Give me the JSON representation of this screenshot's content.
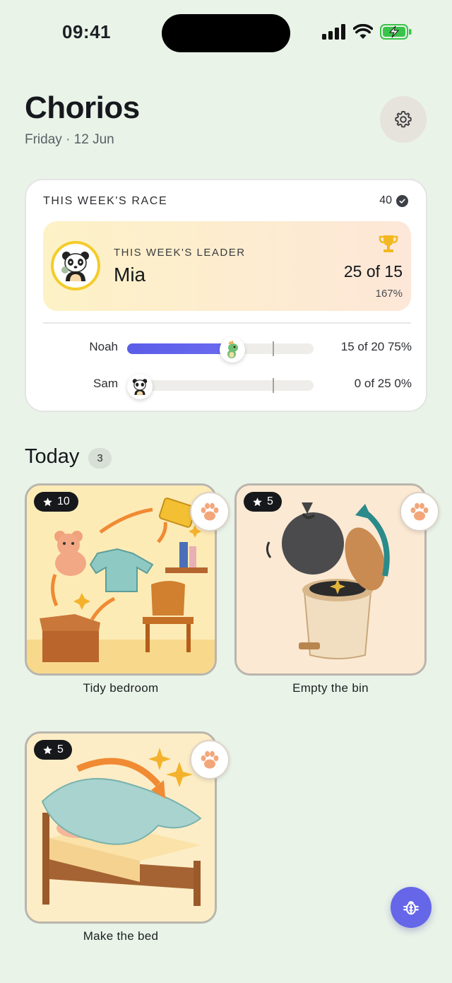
{
  "status_bar": {
    "time": "09:41"
  },
  "header": {
    "title": "Chorios",
    "date": "Friday · 12 Jun"
  },
  "race": {
    "title": "THIS WEEK'S RACE",
    "points": "40",
    "leader": {
      "label": "THIS WEEK'S LEADER",
      "name": "Mia",
      "score": "25 of 15",
      "percent": "167%"
    },
    "racers": [
      {
        "name": "Noah",
        "stat": "15 of 20 75%",
        "progress": 0.75
      },
      {
        "name": "Sam",
        "stat": "0 of 25 0%",
        "progress": 0
      }
    ]
  },
  "today": {
    "title": "Today",
    "count": "3",
    "chores": [
      {
        "label": "Tidy bedroom",
        "stars": "10"
      },
      {
        "label": "Empty the bin",
        "stars": "5"
      },
      {
        "label": "Make the bed",
        "stars": "5"
      }
    ]
  },
  "colors": {
    "accent": "#5b5de8",
    "background": "#e9f3e8",
    "leader_ring": "#f4cc2a",
    "trophy": "#f2b822"
  },
  "icons": {
    "settings": "gear-icon",
    "trophy": "trophy-icon",
    "paw": "paw-icon",
    "star": "star-icon",
    "debug": "bug-icon"
  }
}
